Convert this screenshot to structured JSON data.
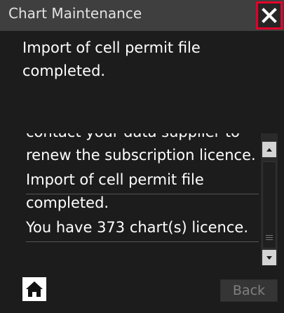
{
  "window": {
    "title": "Chart Maintenance"
  },
  "message": {
    "text": "Import of cell permit file completed."
  },
  "log": {
    "items": [
      "contact your data supplier to renew the subscription licence.",
      "Import of cell permit file completed.",
      "You have 373 chart(s) licence."
    ]
  },
  "buttons": {
    "back_label": "Back"
  },
  "icons": {
    "close": "close-icon",
    "home": "home-icon",
    "scroll_up": "arrow-up-icon",
    "scroll_down": "arrow-down-icon"
  },
  "colors": {
    "highlight": "#e4002b",
    "background": "#1c1c1c",
    "titlebar": "#3f3f3f"
  }
}
